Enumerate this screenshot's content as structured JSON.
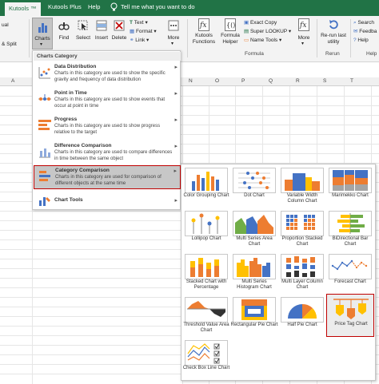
{
  "tabs": [
    {
      "label": "Kutools ™",
      "active": true
    },
    {
      "label": "Kutools Plus",
      "active": false
    },
    {
      "label": "Help",
      "active": false
    },
    {
      "label": "Tell me what you want to do",
      "active": false
    }
  ],
  "ribbon": {
    "left_fragments": [
      "ual",
      "& Split"
    ],
    "charts_label": "Charts",
    "find_label": "Find",
    "select_label": "Select",
    "insert_label": "Insert",
    "delete_label": "Delete",
    "text_label": "Text",
    "format_label": "Format",
    "link_label": "Link",
    "more_label": "More",
    "kutools_functions_label": "Kutools Functions",
    "formula_helper_label": "Formula Helper",
    "exact_copy_label": "Exact Copy",
    "super_lookup_label": "Super LOOKUP",
    "name_tools_label": "Name Tools",
    "more2_label": "More",
    "rerun_label": "Re-run last utility",
    "search_label": "Search",
    "feedback_label": "Feedba",
    "help_label": "Help",
    "group_formula": "Formula",
    "group_rerun": "Rerun",
    "group_help": "Help"
  },
  "columns": [
    "A",
    "N",
    "O",
    "P",
    "Q",
    "R",
    "S",
    "T"
  ],
  "menu": {
    "header": "Charts Category",
    "items": [
      {
        "title": "Data Distribution",
        "desc": "Charts in this category are used to show the specific gravity and frequency of data distribution",
        "highlighted": false
      },
      {
        "title": "Point in Time",
        "desc": "Charts in this category are used to show events that occur at point in time",
        "highlighted": false
      },
      {
        "title": "Progress",
        "desc": "Charts in this category are used to show progress relative to the target",
        "highlighted": false
      },
      {
        "title": "Difference Comparison",
        "desc": "Charts in this category are used to compare differences in time between the same object",
        "highlighted": false
      },
      {
        "title": "Category Comparison",
        "desc": "Charts in this category are used for comparison of different objects at the same time",
        "highlighted": true
      },
      {
        "title": "Chart Tools",
        "desc": "",
        "highlighted": false
      }
    ]
  },
  "submenu": {
    "items": [
      "Color Grouping Chart",
      "Dot Chart",
      "Variable Width Column Chart",
      "Marimekko Chart",
      "Lollipop Chart",
      "Multi Series Area Chart",
      "Proportion Stacked Chart",
      "BiDirectional Bar Chart",
      "Stacked Chart with Percentage",
      "Multi Series Histogram Chart",
      "Multi Layer Column Chart",
      "Forecast Chart",
      "Threshold Value Area Chart",
      "Rectangular Pie Chart",
      "Half Pie Chart",
      "Price Tag Chart",
      "Check Box Line Chart"
    ],
    "highlighted": "Price Tag Chart"
  },
  "colors": {
    "excel_green": "#217346",
    "highlight_red": "#c00000",
    "accent_blue": "#4472c4",
    "accent_orange": "#ed7d31",
    "accent_gold": "#ffc000"
  }
}
